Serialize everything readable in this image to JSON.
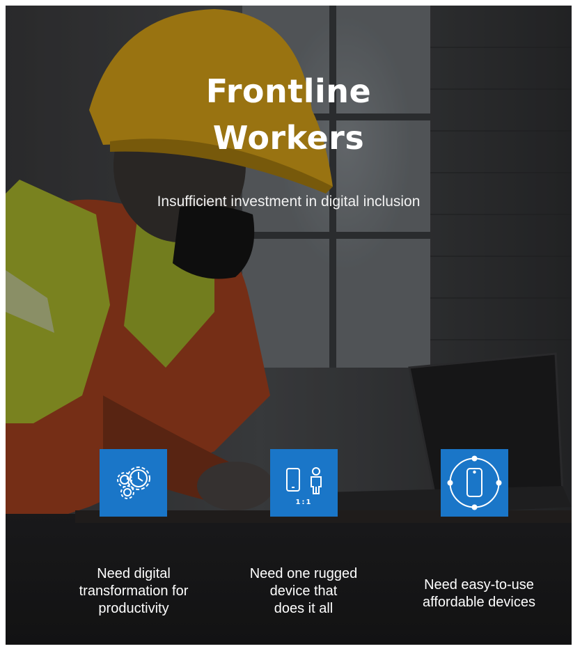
{
  "title": {
    "line1": "Frontline",
    "line2": "Workers"
  },
  "subtitle": "Insufficient investment in digital inclusion",
  "features": [
    {
      "icon": "gears-clock-icon",
      "lines": [
        "Need digital",
        "transformation for",
        "productivity"
      ]
    },
    {
      "icon": "phone-person-icon",
      "icon_text": "1:1",
      "lines": [
        "Need one rugged",
        "device that",
        "does it all"
      ]
    },
    {
      "icon": "phone-orbit-icon",
      "lines": [
        "Need easy-to-use",
        "affordable devices"
      ]
    }
  ],
  "colors": {
    "icon_tile": "#1a76c8",
    "text": "#ffffff"
  }
}
